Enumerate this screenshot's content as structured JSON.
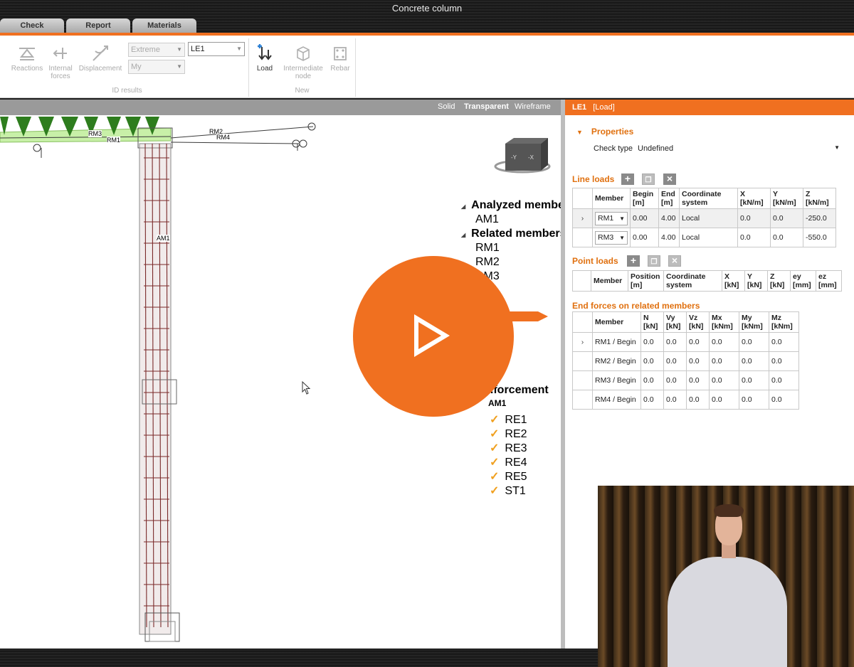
{
  "window": {
    "title": "Concrete column"
  },
  "tabs": [
    {
      "label": "Check"
    },
    {
      "label": "Report"
    },
    {
      "label": "Materials"
    }
  ],
  "ribbon": {
    "results_group": {
      "caption": "ID results",
      "reactions": "Reactions",
      "internal_forces_line1": "Internal",
      "internal_forces_line2": "forces",
      "displacement": "Displacement",
      "extreme_combo": "Extreme",
      "component_combo": "My",
      "load_case_combo": "LE1"
    },
    "new_group": {
      "caption": "New",
      "load": "Load",
      "intermediate_node_line1": "Intermediate",
      "intermediate_node_line2": "node",
      "rebar": "Rebar"
    }
  },
  "view": {
    "modes": {
      "solid": "Solid",
      "transparent": "Transparent",
      "wireframe": "Wireframe"
    },
    "member_labels": {
      "rm3": "RM3",
      "rm1": "RM1",
      "rm2": "RM2",
      "rm4": "RM4",
      "am1": "AM1"
    },
    "tree": {
      "analyzed_header": "Analyzed members",
      "analyzed": [
        "AM1"
      ],
      "related_header": "Related members",
      "related": [
        "RM1",
        "RM2",
        "RM3"
      ],
      "reinforcement_header": "...forcement",
      "reinforcement_member": "AM1",
      "reinforcement_items": [
        "RE1",
        "RE2",
        "RE3",
        "RE4",
        "RE5",
        "ST1"
      ]
    }
  },
  "panel": {
    "header_title": "LE1",
    "header_sub": "[Load]",
    "properties": {
      "title": "Properties",
      "check_type_label": "Check type",
      "check_type_value": "Undefined"
    },
    "line_loads": {
      "title": "Line loads",
      "headers": [
        "Member",
        "Begin [m]",
        "End [m]",
        "Coordinate system",
        "X [kN/m]",
        "Y [kN/m]",
        "Z [kN/m]"
      ],
      "rows": [
        {
          "member": "RM1",
          "begin": "0.00",
          "end": "4.00",
          "cs": "Local",
          "x": "0.0",
          "y": "0.0",
          "z": "-250.0"
        },
        {
          "member": "RM3",
          "begin": "0.00",
          "end": "4.00",
          "cs": "Local",
          "x": "0.0",
          "y": "0.0",
          "z": "-550.0"
        }
      ]
    },
    "point_loads": {
      "title": "Point loads",
      "headers": [
        "Member",
        "Position [m]",
        "Coordinate system",
        "X [kN]",
        "Y [kN]",
        "Z [kN]",
        "ey [mm]",
        "ez [mm]"
      ]
    },
    "end_forces": {
      "title": "End forces on related members",
      "headers": [
        "Member",
        "N [kN]",
        "Vy [kN]",
        "Vz [kN]",
        "Mx [kNm]",
        "My [kNm]",
        "Mz [kNm]"
      ],
      "rows": [
        {
          "member": "RM1 / Begin",
          "n": "0.0",
          "vy": "0.0",
          "vz": "0.0",
          "mx": "0.0",
          "my": "0.0",
          "mz": "0.0"
        },
        {
          "member": "RM2 / Begin",
          "n": "0.0",
          "vy": "0.0",
          "vz": "0.0",
          "mx": "0.0",
          "my": "0.0",
          "mz": "0.0"
        },
        {
          "member": "RM3 / Begin",
          "n": "0.0",
          "vy": "0.0",
          "vz": "0.0",
          "mx": "0.0",
          "my": "0.0",
          "mz": "0.0"
        },
        {
          "member": "RM4 / Begin",
          "n": "0.0",
          "vy": "0.0",
          "vz": "0.0",
          "mx": "0.0",
          "my": "0.0",
          "mz": "0.0"
        }
      ]
    }
  },
  "colors": {
    "accent": "#f07020",
    "section": "#e0700f"
  }
}
